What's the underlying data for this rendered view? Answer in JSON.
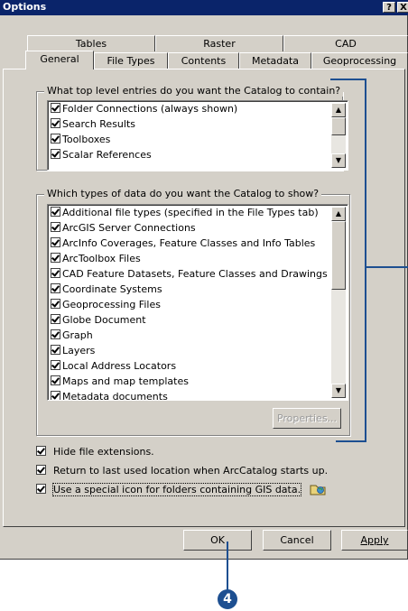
{
  "window": {
    "title": "Options",
    "help_button": "?",
    "close_button": "X"
  },
  "tabs": {
    "row_back": [
      "Tables",
      "Raster",
      "CAD"
    ],
    "row_front": [
      "General",
      "File Types",
      "Contents",
      "Metadata",
      "Geoprocessing"
    ],
    "selected": "General"
  },
  "group_top": {
    "legend": "What top level entries do you want the Catalog to contain?",
    "items": [
      "Folder Connections (always shown)",
      "Search Results",
      "Toolboxes",
      "Scalar References"
    ]
  },
  "group_types": {
    "legend": "Which types of data do you want the Catalog to show?",
    "items": [
      "Additional file types (specified in the File Types tab)",
      "ArcGIS Server Connections",
      "ArcInfo Coverages, Feature Classes and Info Tables",
      "ArcToolbox Files",
      "CAD Feature Datasets, Feature Classes and Drawings",
      "Coordinate Systems",
      "Geoprocessing Files",
      "Globe Document",
      "Graph",
      "Layers",
      "Local Address Locators",
      "Maps and map templates",
      "Metadata documents"
    ],
    "properties_button": "Properties..."
  },
  "options": {
    "hide_ext": "Hide file extensions.",
    "return_last": "Return to last used location when ArcCatalog starts up.",
    "special_icon": "Use a special icon for folders containing GIS data."
  },
  "buttons": {
    "ok": "OK",
    "cancel": "Cancel",
    "apply": "Apply"
  },
  "callout": {
    "number": "4"
  },
  "colors": {
    "callout": "#1d4f91",
    "titlebar": "#0a246a",
    "face": "#d4d0c8"
  }
}
